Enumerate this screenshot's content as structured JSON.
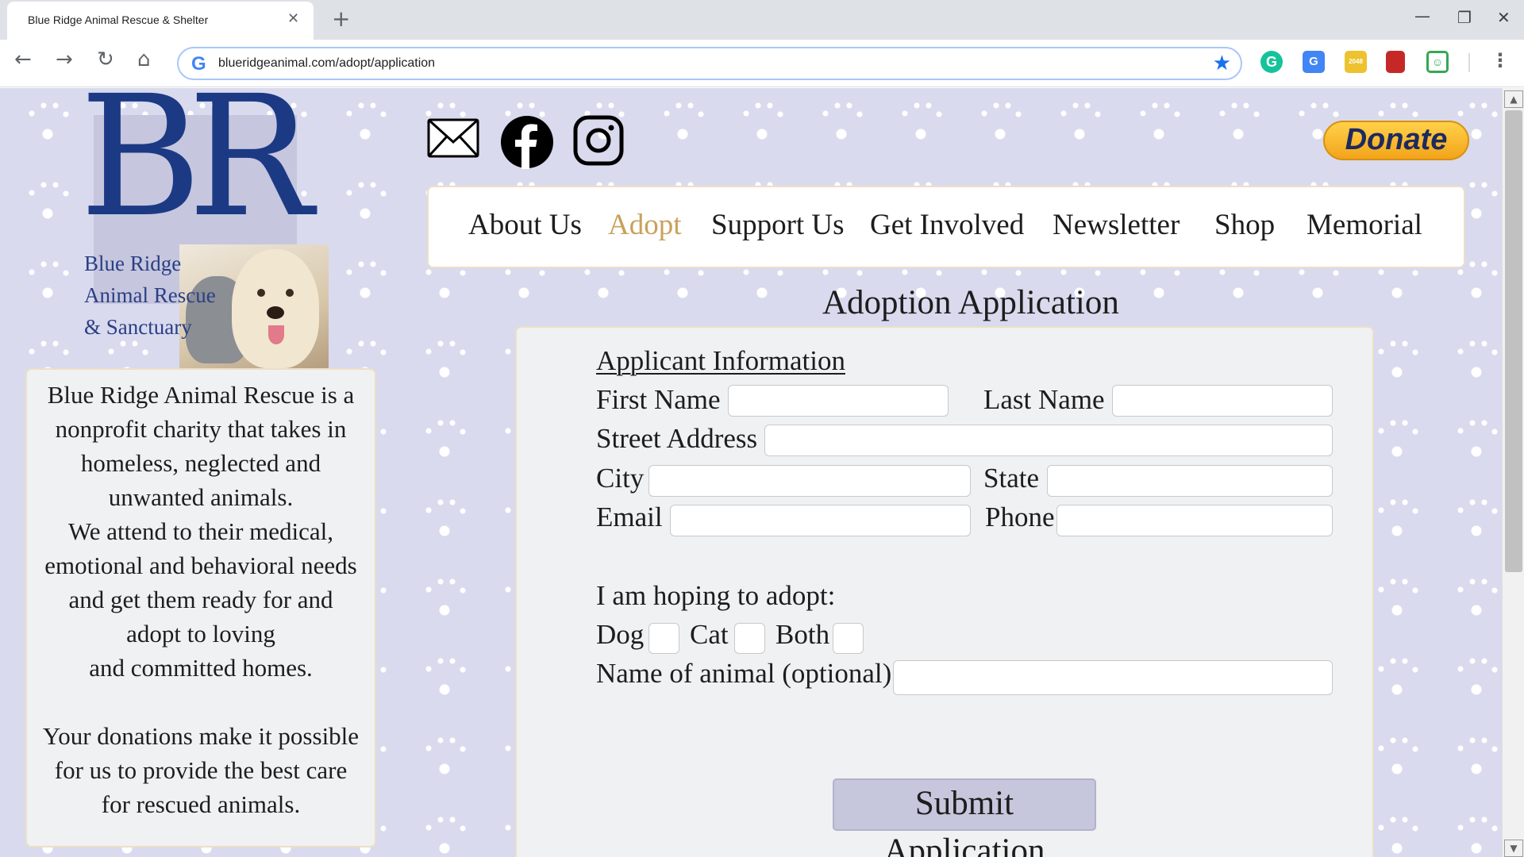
{
  "browser": {
    "tab_title": "Blue Ridge Animal Rescue & Shelter",
    "tab_close_glyph": "✕",
    "new_tab_glyph": "+",
    "url": "blueridgeanimal.com/adopt/application",
    "buttons": {
      "back": "←",
      "forward": "→",
      "reload": "↻",
      "home": "⌂",
      "star": "★",
      "menu": "⋮"
    },
    "extensions": [
      {
        "name": "grammarly-icon",
        "glyph": "G"
      },
      {
        "name": "google-translate-icon",
        "glyph": "G"
      },
      {
        "name": "game-2048-icon",
        "glyph": "2048"
      },
      {
        "name": "book-icon",
        "glyph": ""
      },
      {
        "name": "green-extension-icon",
        "glyph": "☺"
      }
    ],
    "window": {
      "minimize": "—",
      "maximize": "❐",
      "close": "✕"
    }
  },
  "logo": {
    "letters": "BR",
    "lines": [
      "Blue Ridge",
      "Animal Rescue",
      "& Sanctuary"
    ],
    "colors": {
      "navy": "#1c3a84",
      "box": "#c6c6de"
    }
  },
  "info_card": {
    "paragraph1": "Blue Ridge Animal Rescue is a\nnonprofit charity that takes in\nhomeless, neglected and\nunwanted animals.\nWe attend to their medical,\nemotional and behavioral needs\nand get them ready for and\nadopt to loving\nand committed homes.",
    "paragraph2": "Your donations make it possible\nfor us to provide the best care\nfor rescued animals."
  },
  "social": [
    "mail-icon",
    "facebook-icon",
    "instagram-icon"
  ],
  "donate_label": "Donate",
  "nav": {
    "items": [
      "About Us",
      "Adopt",
      "Support Us",
      "Get Involved",
      "Newsletter",
      "Shop",
      "Memorial"
    ],
    "active": "Adopt",
    "active_color": "#c9a05a"
  },
  "page_title": "Adoption Application",
  "form": {
    "section_heading": "Applicant Information",
    "labels": {
      "first_name": "First Name",
      "last_name": "Last Name",
      "street": "Street Address",
      "city": "City",
      "state": "State",
      "email": "Email",
      "phone": "Phone",
      "hoping": "I am hoping to adopt:",
      "dog": "Dog",
      "cat": "Cat",
      "both": "Both",
      "animal_name": "Name of animal (optional)"
    },
    "values": {
      "first_name": "",
      "last_name": "",
      "street": "",
      "city": "",
      "state": "",
      "email": "",
      "phone": "",
      "animal_name": ""
    },
    "submit_label": "Submit Application"
  },
  "colors": {
    "page_bg": "#d9daee",
    "card_bg": "#f0f1f3",
    "card_border": "#ecdfc7",
    "button_bg": "#c6c6dc",
    "donate_gold": "#f2a41a"
  }
}
